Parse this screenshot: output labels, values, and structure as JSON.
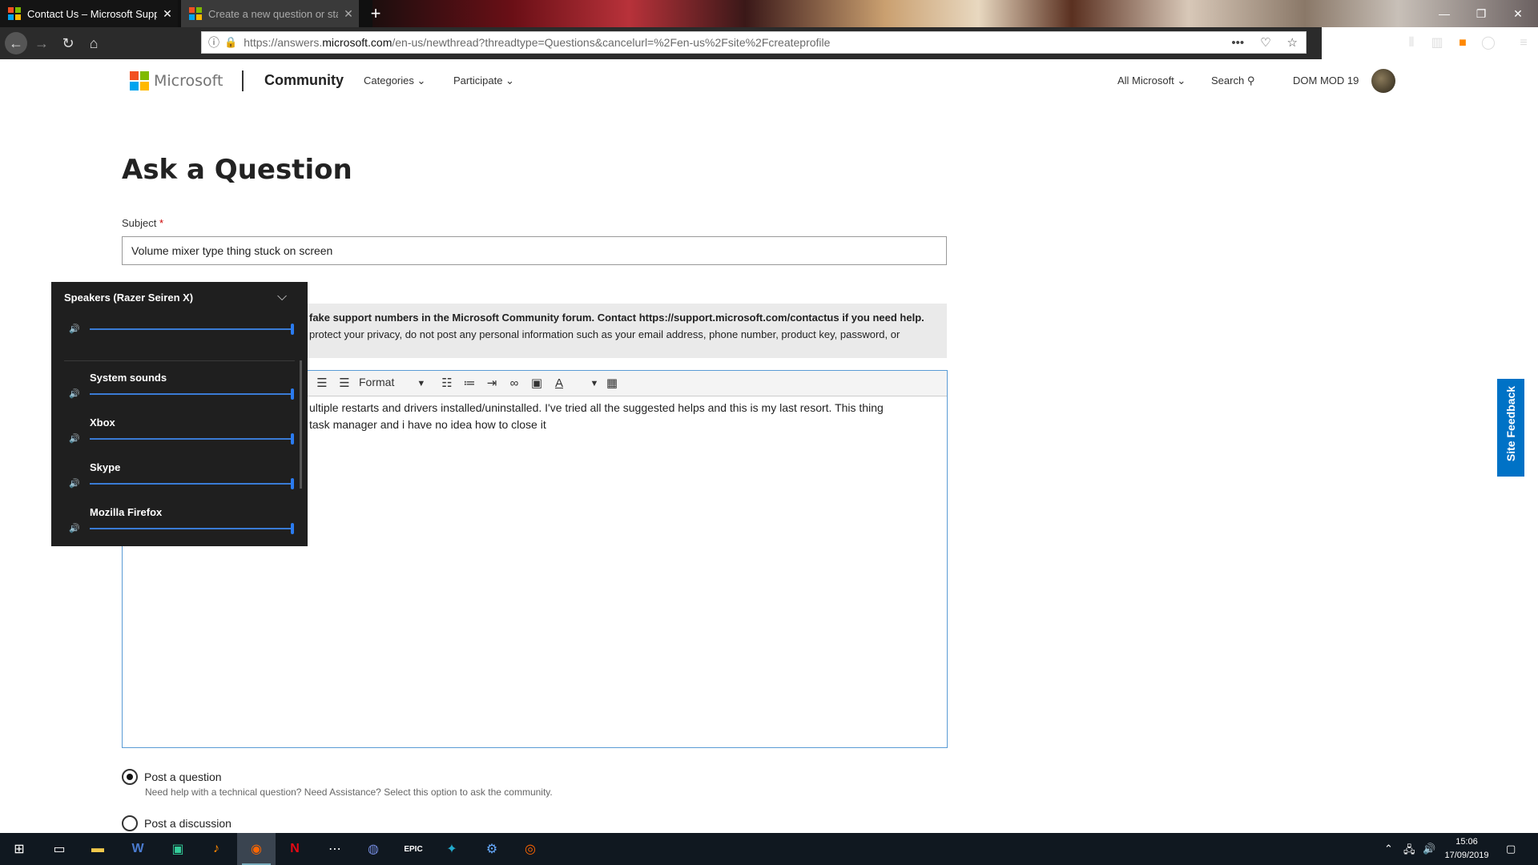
{
  "browser": {
    "tabs": [
      {
        "title": "Contact Us – Microsoft Support",
        "active": true
      },
      {
        "title": "Create a new question or start a",
        "active": false
      }
    ],
    "url_prefix": "https://answers.",
    "url_domain": "microsoft.com",
    "url_path": "/en-us/newthread?threadtype=Questions&cancelurl=%2Fen-us%2Fsite%2Fcreateprofile",
    "url_menu": "•••"
  },
  "header": {
    "brand": "Microsoft",
    "section": "Community",
    "nav": {
      "categories": "Categories",
      "participate": "Participate"
    },
    "all_microsoft": "All Microsoft",
    "search": "Search",
    "user": "DOM MOD 19"
  },
  "form": {
    "title": "Ask a Question",
    "subject_label": "Subject",
    "required_mark": "*",
    "subject_value": "Volume mixer type thing stuck on screen",
    "notice_line1": "fake support numbers in the Microsoft Community forum. Contact https://support.microsoft.com/contactus if you need help.",
    "notice_line2": "protect your privacy, do not post any personal information such as your email address, phone number, product key, password, or",
    "editor_format": "Format",
    "editor_text_line1": "ultiple restarts and drivers installed/uninstalled. I've tried all the suggested helps and this is my last resort. This thing",
    "editor_text_line2": "task manager and i have no idea how to close it",
    "post_question_label": "Post a question",
    "post_question_desc": "Need help with a technical question? Need Assistance? Select this option to ask the community.",
    "post_discussion_label": "Post a discussion",
    "site_feedback": "Site Feedback"
  },
  "mixer": {
    "device": "Speakers (Razer Seiren X)",
    "apps": [
      "System sounds",
      "Xbox",
      "Skype",
      "Mozilla Firefox"
    ],
    "levels": {
      "device": 1.0,
      "System sounds": 1.0,
      "Xbox": 1.0,
      "Skype": 1.0,
      "Mozilla Firefox": 1.0
    }
  },
  "taskbar": {
    "time": "15:06",
    "date": "17/09/2019",
    "icons": [
      "windows-start-icon",
      "task-view-icon",
      "file-explorer-icon",
      "word-icon",
      "gamepad-app-icon",
      "winamp-icon",
      "firefox-icon",
      "netflix-icon",
      "dots-app-icon",
      "discord-icon",
      "epic-games-icon",
      "battlenet-icon",
      "steam-icon",
      "origin-icon"
    ]
  },
  "colors": {
    "accent": "#0072c6",
    "editor_border": "#5a9bd5",
    "mixer_bg": "#1f1f1f",
    "slider": "#2a7bf0"
  }
}
